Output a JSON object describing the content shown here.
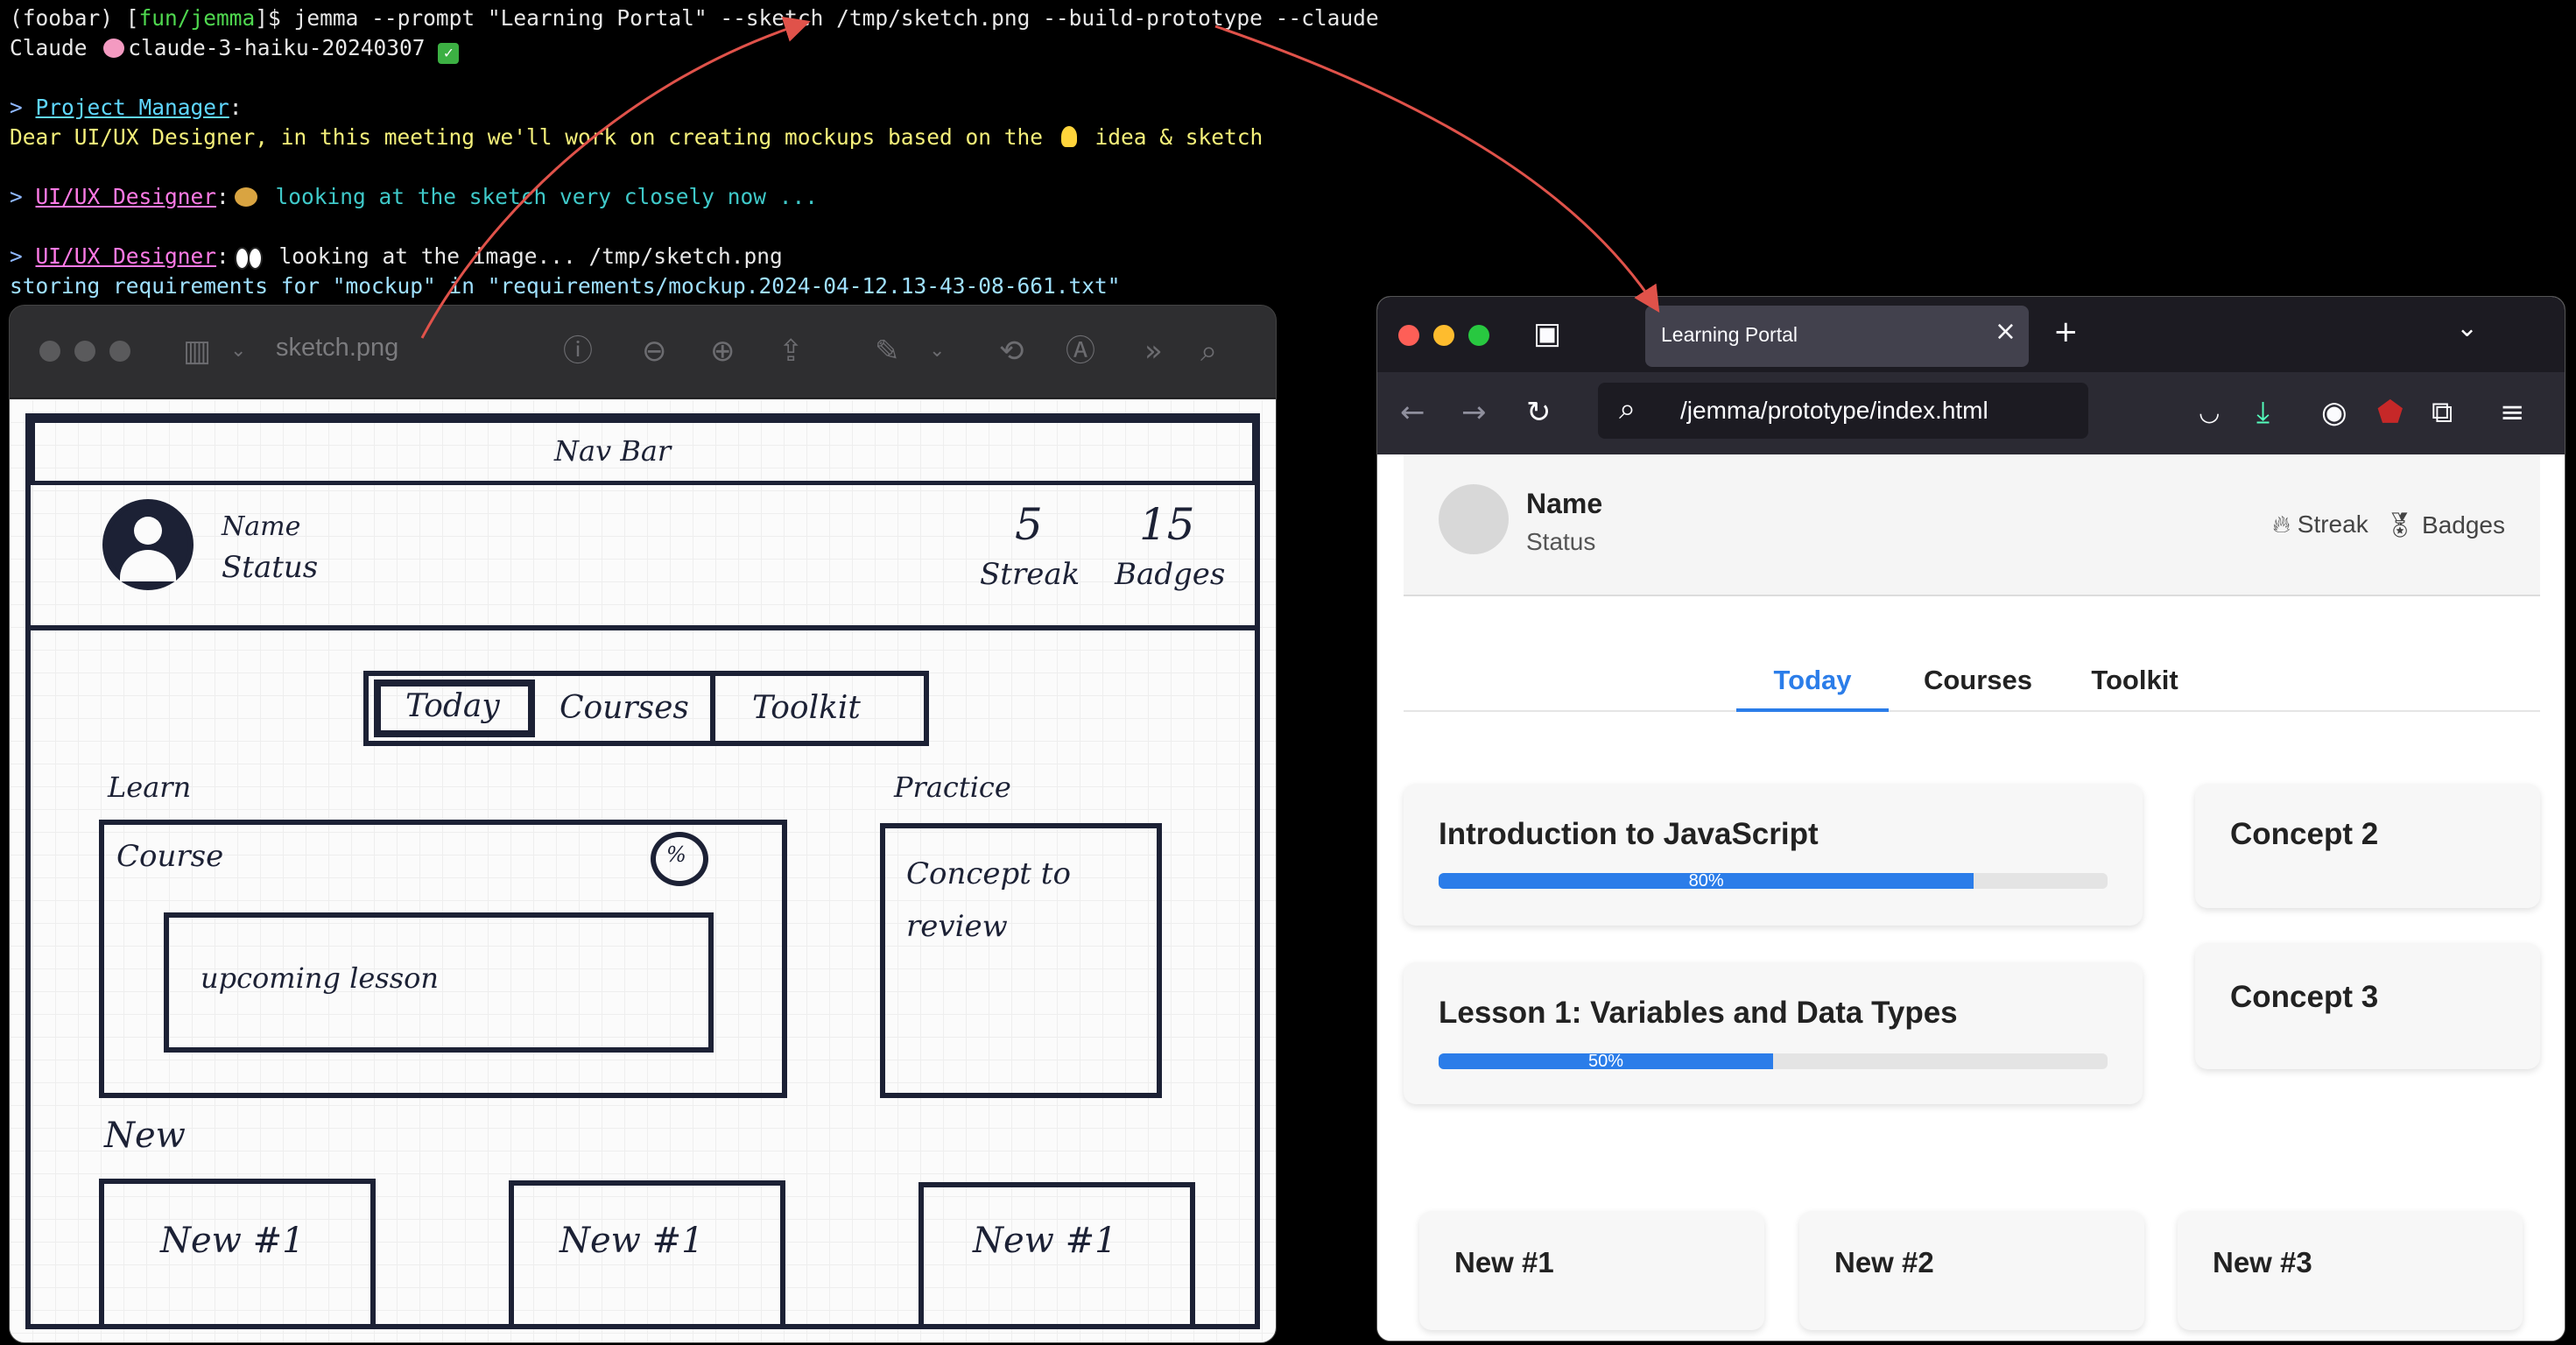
{
  "terminal": {
    "line1_env": "(foobar)",
    "line1_open": " [",
    "line1_dir": "fun/jemma",
    "line1_close": "]$ ",
    "line1_cmd": "jemma --prompt \"Learning Portal\" --sketch /tmp/sketch.png --build-prototype --claude",
    "line2_a": "Claude ",
    "line2_model": "claude-3-haiku-20240307",
    "pm_prompt": "> ",
    "pm_name": "Project Manager",
    "pm_colon": ":",
    "pm_message_a": "Dear UI/UX Designer, in this meeting we'll work on creating mockups based on the ",
    "pm_message_b": " idea & sketch",
    "ux1_prompt": "> ",
    "ux1_name": "UI/UX Designer",
    "ux1_colon": ":",
    "ux1_message": " looking at the sketch very closely now ...",
    "ux2_prompt": "> ",
    "ux2_name": "UI/UX Designer",
    "ux2_colon": ":",
    "ux2_message": " looking at the image... /tmp/sketch.png",
    "storing": "storing requirements for \"mockup\" in \"requirements/mockup.2024-04-12.13-43-08-661.txt\""
  },
  "preview": {
    "title": "sketch.png",
    "icons": [
      "sidebar-icon",
      "chevron-down-icon",
      "info-icon",
      "zoom-out-icon",
      "zoom-in-icon",
      "share-icon",
      "markup-icon",
      "rotate-icon",
      "annotate-icon",
      "more-icon",
      "search-icon"
    ]
  },
  "sketch": {
    "nav_bar": "Nav Bar",
    "name": "Name",
    "status": "Status",
    "streak_value": "5",
    "streak_label": "Streak",
    "badges_value": "15",
    "badges_label": "Badges",
    "tabs": [
      "Today",
      "Courses",
      "Toolkit"
    ],
    "learn": "Learn",
    "course": "Course",
    "percent": "%",
    "upcoming": "upcoming lesson",
    "practice": "Practice",
    "concept_line1": "Concept to",
    "concept_line2": "review",
    "new_heading": "New",
    "new_items": [
      "New #1",
      "New #1",
      "New #1"
    ]
  },
  "browser": {
    "tab_title": "Learning Portal",
    "url": "/jemma/prototype/index.html"
  },
  "page": {
    "profile": {
      "name": "Name",
      "status": "Status",
      "streak": "Streak",
      "badges": "Badges"
    },
    "tabs": [
      "Today",
      "Courses",
      "Toolkit"
    ],
    "courses": [
      {
        "title": "Introduction to JavaScript",
        "progress": 0.8,
        "label": "80%"
      },
      {
        "title": "Lesson 1: Variables and Data Types",
        "progress": 0.5,
        "label": "50%"
      }
    ],
    "concepts": [
      "Concept 2",
      "Concept 3"
    ],
    "new_items": [
      "New #1",
      "New #2",
      "New #3"
    ]
  },
  "colors": {
    "accent": "#2b7de9",
    "arrow": "#e0524a",
    "sketch_ink": "#1c2135"
  }
}
